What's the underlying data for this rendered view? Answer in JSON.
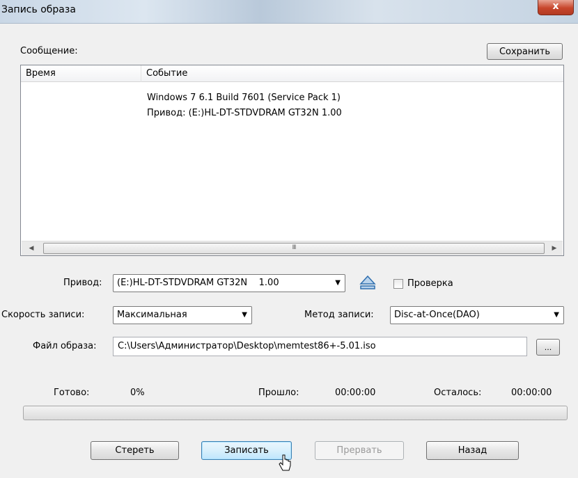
{
  "window": {
    "title": "Запись образа",
    "close_glyph": "x"
  },
  "message": {
    "label": "Сообщение:",
    "save_button": "Сохранить",
    "columns": [
      "Время",
      "Событие"
    ],
    "rows": [
      {
        "time": "",
        "event": "Windows 7 6.1 Build 7601 (Service Pack 1)"
      },
      {
        "time": "",
        "event": "Привод: (E:)HL-DT-STDVDRAM GT32N    1.00"
      }
    ],
    "scroll_left": "◀",
    "scroll_right": "▶",
    "scroll_grip": "III"
  },
  "drive": {
    "label": "Привод:",
    "value": "(E:)HL-DT-STDVDRAM GT32N    1.00",
    "eject_icon": "eject-icon"
  },
  "verify": {
    "label": "Проверка",
    "checked": false
  },
  "speed": {
    "label": "Скорость записи:",
    "value": "Максимальная"
  },
  "method": {
    "label": "Метод записи:",
    "value": "Disc-at-Once(DAO)"
  },
  "image_file": {
    "label": "Файл образа:",
    "value": "C:\\Users\\Администратор\\Desktop\\memtest86+-5.01.iso",
    "browse_label": "..."
  },
  "status": {
    "ready_label": "Готово:",
    "ready_value": "0%",
    "elapsed_label": "Прошло:",
    "elapsed_value": "00:00:00",
    "remaining_label": "Осталось:",
    "remaining_value": "00:00:00",
    "progress_fraction": 0
  },
  "buttons": {
    "erase": "Стереть",
    "write": "Записать",
    "abort": "Прервать",
    "back": "Назад"
  },
  "colors": {
    "progress_fill": "#37c23c",
    "focus_border": "#3c7fb1",
    "close_red": "#c7462c"
  }
}
